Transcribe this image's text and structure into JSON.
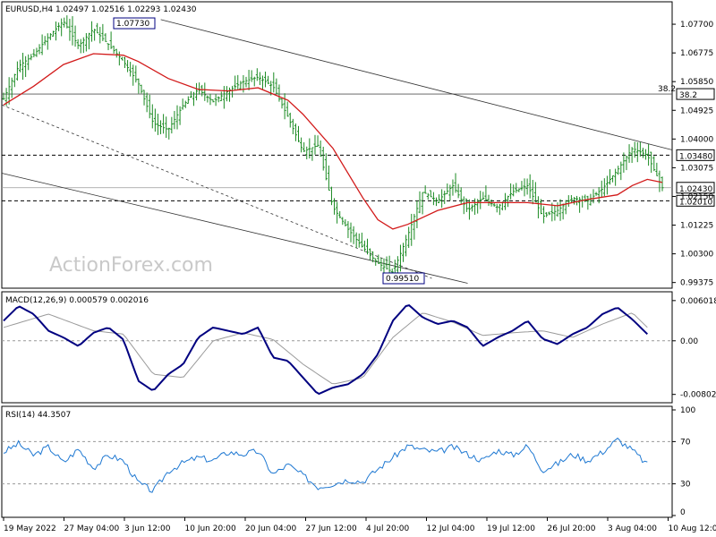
{
  "header": {
    "price": "EURUSD,H4  1.02497 1.02516 1.02293 1.02430",
    "macd": "MACD(12,26,9) 0.000579 0.002016",
    "rsi": "RSI(14) 44.3507"
  },
  "watermark": "ActionForex.com",
  "colors": {
    "ohlc": "#1a8a22",
    "sma": "#d21a1a",
    "macd_line": "#000080",
    "macd_signal": "#9a9a9a",
    "rsi_line": "#1e78d2",
    "level_line": "#555555",
    "dashed": "#000000"
  },
  "chart_data": [
    {
      "type": "line",
      "symbol": "EURUSD",
      "timeframe": "H4",
      "ylim": [
        0.9925,
        1.0825
      ],
      "yticks": [
        "1.07700",
        "1.06775",
        "1.05850",
        "1.04925",
        "1.04000",
        "1.03075",
        "1.02150",
        "1.01225",
        "1.00300",
        "0.99375"
      ],
      "xticks": [
        "19 May 2022",
        "27 May 04:00",
        "3 Jun 12:00",
        "10 Jun 20:00",
        "20 Jun 04:00",
        "27 Jun 12:00",
        "4 Jul 20:00",
        "12 Jul 04:00",
        "19 Jul 12:00",
        "26 Jul 20:00",
        "3 Aug 04:00",
        "10 Aug 12:00"
      ],
      "price_path": [
        [
          0,
          1.053
        ],
        [
          1,
          1.0635
        ],
        [
          2,
          1.067
        ],
        [
          3,
          1.073
        ],
        [
          4,
          1.078
        ],
        [
          5,
          1.07
        ],
        [
          6,
          1.0755
        ],
        [
          7,
          1.0705
        ],
        [
          8,
          1.065
        ],
        [
          9,
          1.058
        ],
        [
          10,
          1.045
        ],
        [
          11,
          1.043
        ],
        [
          12,
          1.051
        ],
        [
          13,
          1.056
        ],
        [
          14,
          1.052
        ],
        [
          15,
          1.0555
        ],
        [
          16,
          1.0585
        ],
        [
          17,
          1.06
        ],
        [
          18,
          1.057
        ],
        [
          19,
          1.047
        ],
        [
          20,
          1.036
        ],
        [
          21,
          1.038
        ],
        [
          22,
          1.018
        ],
        [
          23,
          1.011
        ],
        [
          24,
          1.005
        ],
        [
          25,
          1.0
        ],
        [
          26,
          0.997
        ],
        [
          27,
          1.009
        ],
        [
          28,
          1.023
        ],
        [
          29,
          1.02
        ],
        [
          30,
          1.025
        ],
        [
          31,
          1.017
        ],
        [
          32,
          1.021
        ],
        [
          33,
          1.018
        ],
        [
          34,
          1.023
        ],
        [
          35,
          1.025
        ],
        [
          36,
          1.015
        ],
        [
          37,
          1.017
        ],
        [
          38,
          1.021
        ],
        [
          39,
          1.02
        ],
        [
          40,
          1.024
        ],
        [
          41,
          1.03
        ],
        [
          42,
          1.037
        ],
        [
          43,
          1.0348
        ],
        [
          44,
          1.0243
        ]
      ],
      "sma_path": [
        [
          0,
          1.051
        ],
        [
          2,
          1.057
        ],
        [
          4,
          1.064
        ],
        [
          6,
          1.0675
        ],
        [
          8,
          1.067
        ],
        [
          9,
          1.065
        ],
        [
          11,
          1.0595
        ],
        [
          13,
          1.056
        ],
        [
          15,
          1.0555
        ],
        [
          17,
          1.0565
        ],
        [
          19,
          1.0525
        ],
        [
          20,
          1.048
        ],
        [
          22,
          1.037
        ],
        [
          24,
          1.021
        ],
        [
          25,
          1.014
        ],
        [
          26,
          1.011
        ],
        [
          27,
          1.0125
        ],
        [
          29,
          1.017
        ],
        [
          31,
          1.0195
        ],
        [
          33,
          1.0195
        ],
        [
          35,
          1.0195
        ],
        [
          37,
          1.0185
        ],
        [
          39,
          1.0205
        ],
        [
          41,
          1.022
        ],
        [
          42,
          1.025
        ],
        [
          43,
          1.027
        ],
        [
          44,
          1.026
        ]
      ],
      "levels": [
        {
          "value": 1.0773,
          "label": "1.07730",
          "style": "box"
        },
        {
          "value": 1.0545,
          "label": "38.2",
          "style": "solid"
        },
        {
          "value": 1.0348,
          "label": "1.03480",
          "style": "dashed"
        },
        {
          "value": 1.0243,
          "label": "1.02430",
          "style": "solid-gray"
        },
        {
          "value": 1.0201,
          "label": "1.02010",
          "style": "dashed"
        },
        {
          "value": 0.9951,
          "label": "0.99510",
          "style": "box"
        }
      ]
    },
    {
      "type": "line",
      "name": "MACD(12,26,9)",
      "ylim": [
        -0.009,
        0.0068
      ],
      "yticks": [
        "0.006018",
        "0.00",
        "-0.00802"
      ],
      "macd_path": [
        [
          0,
          0.003
        ],
        [
          1,
          0.0052
        ],
        [
          2,
          0.004
        ],
        [
          3,
          0.0015
        ],
        [
          4,
          0.0005
        ],
        [
          5,
          -0.0008
        ],
        [
          6,
          0.0012
        ],
        [
          7,
          0.002
        ],
        [
          8,
          0.0002
        ],
        [
          9,
          -0.006
        ],
        [
          10,
          -0.0075
        ],
        [
          11,
          -0.005
        ],
        [
          12,
          -0.0035
        ],
        [
          13,
          0.0005
        ],
        [
          14,
          0.002
        ],
        [
          15,
          0.0015
        ],
        [
          16,
          0.001
        ],
        [
          17,
          0.002
        ],
        [
          18,
          -0.0025
        ],
        [
          19,
          -0.003
        ],
        [
          20,
          -0.0055
        ],
        [
          21,
          -0.008
        ],
        [
          22,
          -0.007
        ],
        [
          23,
          -0.0065
        ],
        [
          24,
          -0.005
        ],
        [
          25,
          -0.002
        ],
        [
          26,
          0.003
        ],
        [
          27,
          0.0055
        ],
        [
          28,
          0.0035
        ],
        [
          29,
          0.0025
        ],
        [
          30,
          0.003
        ],
        [
          31,
          0.002
        ],
        [
          32,
          -0.0008
        ],
        [
          33,
          0.0005
        ],
        [
          34,
          0.0015
        ],
        [
          35,
          0.003
        ],
        [
          36,
          0.0003
        ],
        [
          37,
          -0.0005
        ],
        [
          38,
          0.001
        ],
        [
          39,
          0.002
        ],
        [
          40,
          0.004
        ],
        [
          41,
          0.005
        ],
        [
          42,
          0.0032
        ],
        [
          43,
          0.001
        ]
      ],
      "signal_path": [
        [
          0,
          0.002
        ],
        [
          3,
          0.004
        ],
        [
          6,
          0.0015
        ],
        [
          8,
          0.001
        ],
        [
          10,
          -0.005
        ],
        [
          12,
          -0.0055
        ],
        [
          14,
          0.0
        ],
        [
          16,
          0.0012
        ],
        [
          18,
          0.0002
        ],
        [
          20,
          -0.0035
        ],
        [
          22,
          -0.0065
        ],
        [
          24,
          -0.0055
        ],
        [
          26,
          0.0005
        ],
        [
          28,
          0.0042
        ],
        [
          30,
          0.0028
        ],
        [
          32,
          0.0008
        ],
        [
          34,
          0.0012
        ],
        [
          36,
          0.0015
        ],
        [
          38,
          0.0005
        ],
        [
          40,
          0.0025
        ],
        [
          42,
          0.0042
        ],
        [
          43,
          0.002
        ]
      ]
    },
    {
      "type": "line",
      "name": "RSI(14)",
      "ylim": [
        0,
        100
      ],
      "yticks": [
        "100",
        "70",
        "30",
        "0"
      ],
      "levels": [
        70,
        30
      ],
      "rsi_path": [
        [
          0,
          60
        ],
        [
          1,
          68
        ],
        [
          2,
          57
        ],
        [
          3,
          65
        ],
        [
          4,
          50
        ],
        [
          5,
          63
        ],
        [
          6,
          45
        ],
        [
          7,
          57
        ],
        [
          8,
          52
        ],
        [
          9,
          31
        ],
        [
          10,
          23
        ],
        [
          11,
          42
        ],
        [
          12,
          50
        ],
        [
          13,
          55
        ],
        [
          14,
          52
        ],
        [
          15,
          60
        ],
        [
          16,
          58
        ],
        [
          17,
          61
        ],
        [
          18,
          39
        ],
        [
          19,
          48
        ],
        [
          20,
          38
        ],
        [
          21,
          27
        ],
        [
          22,
          30
        ],
        [
          23,
          34
        ],
        [
          24,
          32
        ],
        [
          25,
          44
        ],
        [
          26,
          55
        ],
        [
          27,
          66
        ],
        [
          28,
          62
        ],
        [
          29,
          60
        ],
        [
          30,
          65
        ],
        [
          31,
          58
        ],
        [
          32,
          52
        ],
        [
          33,
          62
        ],
        [
          34,
          57
        ],
        [
          35,
          66
        ],
        [
          36,
          43
        ],
        [
          37,
          49
        ],
        [
          38,
          58
        ],
        [
          39,
          52
        ],
        [
          40,
          60
        ],
        [
          41,
          72
        ],
        [
          42,
          62
        ],
        [
          43,
          48
        ]
      ]
    }
  ]
}
